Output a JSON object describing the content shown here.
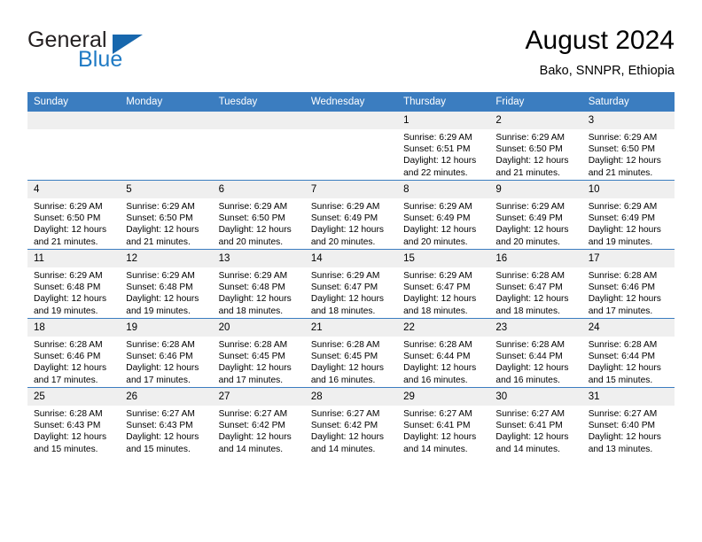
{
  "brand": {
    "word_one": "General",
    "word_two": "Blue",
    "logo_icon": "triangle-icon"
  },
  "header": {
    "title": "August 2024",
    "subtitle": "Bako, SNNPR, Ethiopia"
  },
  "colors": {
    "header_blue": "#3b7dc0",
    "brand_blue": "#1f7ac4",
    "daynum_background": "#efefef",
    "text": "#000000"
  },
  "calendar": {
    "weekday_headers": [
      "Sunday",
      "Monday",
      "Tuesday",
      "Wednesday",
      "Thursday",
      "Friday",
      "Saturday"
    ],
    "weeks": [
      [
        {
          "day": "",
          "empty": true
        },
        {
          "day": "",
          "empty": true
        },
        {
          "day": "",
          "empty": true
        },
        {
          "day": "",
          "empty": true
        },
        {
          "day": "1",
          "sunrise": "Sunrise: 6:29 AM",
          "sunset": "Sunset: 6:51 PM",
          "daylight_1": "Daylight: 12 hours",
          "daylight_2": "and 22 minutes."
        },
        {
          "day": "2",
          "sunrise": "Sunrise: 6:29 AM",
          "sunset": "Sunset: 6:50 PM",
          "daylight_1": "Daylight: 12 hours",
          "daylight_2": "and 21 minutes."
        },
        {
          "day": "3",
          "sunrise": "Sunrise: 6:29 AM",
          "sunset": "Sunset: 6:50 PM",
          "daylight_1": "Daylight: 12 hours",
          "daylight_2": "and 21 minutes."
        }
      ],
      [
        {
          "day": "4",
          "sunrise": "Sunrise: 6:29 AM",
          "sunset": "Sunset: 6:50 PM",
          "daylight_1": "Daylight: 12 hours",
          "daylight_2": "and 21 minutes."
        },
        {
          "day": "5",
          "sunrise": "Sunrise: 6:29 AM",
          "sunset": "Sunset: 6:50 PM",
          "daylight_1": "Daylight: 12 hours",
          "daylight_2": "and 21 minutes."
        },
        {
          "day": "6",
          "sunrise": "Sunrise: 6:29 AM",
          "sunset": "Sunset: 6:50 PM",
          "daylight_1": "Daylight: 12 hours",
          "daylight_2": "and 20 minutes."
        },
        {
          "day": "7",
          "sunrise": "Sunrise: 6:29 AM",
          "sunset": "Sunset: 6:49 PM",
          "daylight_1": "Daylight: 12 hours",
          "daylight_2": "and 20 minutes."
        },
        {
          "day": "8",
          "sunrise": "Sunrise: 6:29 AM",
          "sunset": "Sunset: 6:49 PM",
          "daylight_1": "Daylight: 12 hours",
          "daylight_2": "and 20 minutes."
        },
        {
          "day": "9",
          "sunrise": "Sunrise: 6:29 AM",
          "sunset": "Sunset: 6:49 PM",
          "daylight_1": "Daylight: 12 hours",
          "daylight_2": "and 20 minutes."
        },
        {
          "day": "10",
          "sunrise": "Sunrise: 6:29 AM",
          "sunset": "Sunset: 6:49 PM",
          "daylight_1": "Daylight: 12 hours",
          "daylight_2": "and 19 minutes."
        }
      ],
      [
        {
          "day": "11",
          "sunrise": "Sunrise: 6:29 AM",
          "sunset": "Sunset: 6:48 PM",
          "daylight_1": "Daylight: 12 hours",
          "daylight_2": "and 19 minutes."
        },
        {
          "day": "12",
          "sunrise": "Sunrise: 6:29 AM",
          "sunset": "Sunset: 6:48 PM",
          "daylight_1": "Daylight: 12 hours",
          "daylight_2": "and 19 minutes."
        },
        {
          "day": "13",
          "sunrise": "Sunrise: 6:29 AM",
          "sunset": "Sunset: 6:48 PM",
          "daylight_1": "Daylight: 12 hours",
          "daylight_2": "and 18 minutes."
        },
        {
          "day": "14",
          "sunrise": "Sunrise: 6:29 AM",
          "sunset": "Sunset: 6:47 PM",
          "daylight_1": "Daylight: 12 hours",
          "daylight_2": "and 18 minutes."
        },
        {
          "day": "15",
          "sunrise": "Sunrise: 6:29 AM",
          "sunset": "Sunset: 6:47 PM",
          "daylight_1": "Daylight: 12 hours",
          "daylight_2": "and 18 minutes."
        },
        {
          "day": "16",
          "sunrise": "Sunrise: 6:28 AM",
          "sunset": "Sunset: 6:47 PM",
          "daylight_1": "Daylight: 12 hours",
          "daylight_2": "and 18 minutes."
        },
        {
          "day": "17",
          "sunrise": "Sunrise: 6:28 AM",
          "sunset": "Sunset: 6:46 PM",
          "daylight_1": "Daylight: 12 hours",
          "daylight_2": "and 17 minutes."
        }
      ],
      [
        {
          "day": "18",
          "sunrise": "Sunrise: 6:28 AM",
          "sunset": "Sunset: 6:46 PM",
          "daylight_1": "Daylight: 12 hours",
          "daylight_2": "and 17 minutes."
        },
        {
          "day": "19",
          "sunrise": "Sunrise: 6:28 AM",
          "sunset": "Sunset: 6:46 PM",
          "daylight_1": "Daylight: 12 hours",
          "daylight_2": "and 17 minutes."
        },
        {
          "day": "20",
          "sunrise": "Sunrise: 6:28 AM",
          "sunset": "Sunset: 6:45 PM",
          "daylight_1": "Daylight: 12 hours",
          "daylight_2": "and 17 minutes."
        },
        {
          "day": "21",
          "sunrise": "Sunrise: 6:28 AM",
          "sunset": "Sunset: 6:45 PM",
          "daylight_1": "Daylight: 12 hours",
          "daylight_2": "and 16 minutes."
        },
        {
          "day": "22",
          "sunrise": "Sunrise: 6:28 AM",
          "sunset": "Sunset: 6:44 PM",
          "daylight_1": "Daylight: 12 hours",
          "daylight_2": "and 16 minutes."
        },
        {
          "day": "23",
          "sunrise": "Sunrise: 6:28 AM",
          "sunset": "Sunset: 6:44 PM",
          "daylight_1": "Daylight: 12 hours",
          "daylight_2": "and 16 minutes."
        },
        {
          "day": "24",
          "sunrise": "Sunrise: 6:28 AM",
          "sunset": "Sunset: 6:44 PM",
          "daylight_1": "Daylight: 12 hours",
          "daylight_2": "and 15 minutes."
        }
      ],
      [
        {
          "day": "25",
          "sunrise": "Sunrise: 6:28 AM",
          "sunset": "Sunset: 6:43 PM",
          "daylight_1": "Daylight: 12 hours",
          "daylight_2": "and 15 minutes."
        },
        {
          "day": "26",
          "sunrise": "Sunrise: 6:27 AM",
          "sunset": "Sunset: 6:43 PM",
          "daylight_1": "Daylight: 12 hours",
          "daylight_2": "and 15 minutes."
        },
        {
          "day": "27",
          "sunrise": "Sunrise: 6:27 AM",
          "sunset": "Sunset: 6:42 PM",
          "daylight_1": "Daylight: 12 hours",
          "daylight_2": "and 14 minutes."
        },
        {
          "day": "28",
          "sunrise": "Sunrise: 6:27 AM",
          "sunset": "Sunset: 6:42 PM",
          "daylight_1": "Daylight: 12 hours",
          "daylight_2": "and 14 minutes."
        },
        {
          "day": "29",
          "sunrise": "Sunrise: 6:27 AM",
          "sunset": "Sunset: 6:41 PM",
          "daylight_1": "Daylight: 12 hours",
          "daylight_2": "and 14 minutes."
        },
        {
          "day": "30",
          "sunrise": "Sunrise: 6:27 AM",
          "sunset": "Sunset: 6:41 PM",
          "daylight_1": "Daylight: 12 hours",
          "daylight_2": "and 14 minutes."
        },
        {
          "day": "31",
          "sunrise": "Sunrise: 6:27 AM",
          "sunset": "Sunset: 6:40 PM",
          "daylight_1": "Daylight: 12 hours",
          "daylight_2": "and 13 minutes."
        }
      ]
    ]
  }
}
